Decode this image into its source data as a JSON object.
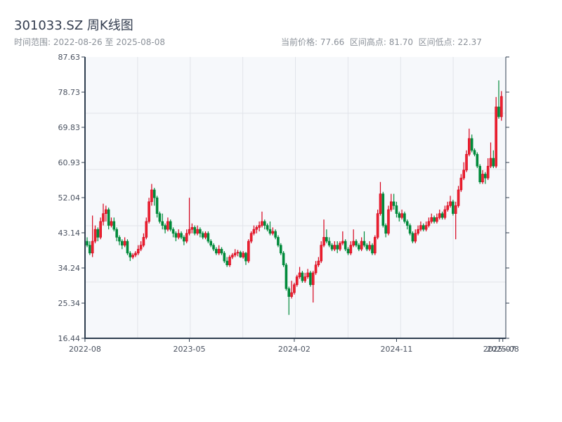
{
  "header": {
    "title": "301033.SZ 周K线图",
    "range_text": "时间范围: 2022-08-26 至 2025-08-08",
    "stats_text": "当前价格: 77.66  区间高点: 81.70  区间低点: 22.37"
  },
  "colors": {
    "up": "#d7001a",
    "up_fill": "#ec2230",
    "down": "#008a3a",
    "axis": "#2f3e50",
    "grid": "#e1e4ea",
    "plot_bg": "#f6f8fb"
  },
  "chart_data": {
    "type": "candlestick",
    "title": "301033.SZ 周K线图",
    "xlabel": "",
    "ylabel": "",
    "start_date": "2022-08-26",
    "end_date": "2025-08-08",
    "interval": "weekly",
    "ylim": [
      16.44,
      87.63
    ],
    "y_ticks": [
      "16.44",
      "25.34",
      "34.24",
      "43.14",
      "52.04",
      "60.93",
      "69.83",
      "78.73",
      "87.63"
    ],
    "x_ticks": [
      {
        "label": "2022-08",
        "index": -0.8
      },
      {
        "label": "2023-05",
        "index": 38
      },
      {
        "label": "2024-02",
        "index": 77
      },
      {
        "label": "2024-11",
        "index": 115
      },
      {
        "label": "2025-07",
        "index": 153.2
      },
      {
        "label": "2025-08",
        "index": 154.5
      }
    ],
    "grid": true,
    "ohlc": [
      [
        41,
        42,
        39.5,
        40
      ],
      [
        40,
        41,
        37.5,
        38
      ],
      [
        38,
        47.5,
        37,
        41
      ],
      [
        41,
        45,
        40.5,
        44
      ],
      [
        44,
        44.5,
        41,
        42
      ],
      [
        42,
        47,
        41.5,
        46
      ],
      [
        46,
        50.5,
        45,
        48
      ],
      [
        48,
        50,
        46,
        49
      ],
      [
        49,
        49.5,
        44,
        45
      ],
      [
        45,
        47,
        44.5,
        46
      ],
      [
        46,
        47,
        43.5,
        44
      ],
      [
        44,
        44.5,
        41,
        42
      ],
      [
        42,
        42.5,
        40,
        41
      ],
      [
        41,
        41.5,
        39,
        40
      ],
      [
        40,
        42,
        39.5,
        41
      ],
      [
        41,
        41.5,
        37.5,
        38
      ],
      [
        38,
        38.5,
        36,
        37
      ],
      [
        37,
        38,
        36.5,
        37.5
      ],
      [
        37.5,
        38.5,
        37,
        38
      ],
      [
        38,
        40,
        37.5,
        39
      ],
      [
        39,
        41,
        38.5,
        40
      ],
      [
        40,
        43,
        39.5,
        42
      ],
      [
        42,
        47,
        41.5,
        46
      ],
      [
        46,
        52,
        45.5,
        51
      ],
      [
        51,
        55.5,
        50,
        54
      ],
      [
        54,
        54.5,
        50,
        52
      ],
      [
        52,
        52.5,
        47,
        48
      ],
      [
        48,
        48.5,
        45.5,
        46
      ],
      [
        46,
        48,
        44,
        45
      ],
      [
        45,
        45.5,
        43,
        44
      ],
      [
        44,
        47,
        43.5,
        46
      ],
      [
        46,
        46.5,
        43.5,
        44
      ],
      [
        44,
        44.5,
        42,
        43
      ],
      [
        43,
        43.5,
        41,
        42
      ],
      [
        42,
        44,
        41.5,
        43
      ],
      [
        43,
        43.5,
        41.5,
        42
      ],
      [
        42,
        42.5,
        40,
        41
      ],
      [
        41,
        44,
        40.5,
        43
      ],
      [
        43,
        52,
        42.5,
        44
      ],
      [
        44,
        45.5,
        43,
        44.5
      ],
      [
        44.5,
        45,
        42.5,
        43
      ],
      [
        43,
        45,
        42.5,
        44
      ],
      [
        44,
        44.5,
        42,
        43
      ],
      [
        43,
        43.5,
        41.5,
        42
      ],
      [
        42,
        43.5,
        41.5,
        43
      ],
      [
        43,
        43.5,
        40.5,
        41
      ],
      [
        41,
        41.5,
        39.5,
        40
      ],
      [
        40,
        40.5,
        38.5,
        39
      ],
      [
        39,
        39.5,
        37.5,
        38
      ],
      [
        38,
        40,
        37.5,
        39
      ],
      [
        39,
        39.5,
        37.5,
        38
      ],
      [
        38,
        38.5,
        35.5,
        36
      ],
      [
        36,
        37,
        34.5,
        35
      ],
      [
        35,
        37.5,
        34.5,
        37
      ],
      [
        37,
        38,
        36.5,
        37.5
      ],
      [
        37.5,
        39,
        37,
        38
      ],
      [
        38,
        38.8,
        37.2,
        38.2
      ],
      [
        38.2,
        38.6,
        36.8,
        37
      ],
      [
        37,
        38.5,
        36.6,
        38
      ],
      [
        38,
        38.3,
        35,
        36
      ],
      [
        36,
        41.5,
        35.5,
        41
      ],
      [
        41,
        43.5,
        40.5,
        43
      ],
      [
        43,
        45,
        42.5,
        44
      ],
      [
        44,
        45,
        43,
        44.5
      ],
      [
        44.5,
        46,
        43.5,
        45
      ],
      [
        45,
        48.5,
        44.5,
        46
      ],
      [
        46,
        46.5,
        44,
        45
      ],
      [
        45,
        45.5,
        43.5,
        44
      ],
      [
        44,
        46,
        42.5,
        43
      ],
      [
        43,
        44.5,
        42.5,
        43.5
      ],
      [
        43.5,
        44,
        41.5,
        42
      ],
      [
        42,
        42.5,
        39.5,
        40
      ],
      [
        40,
        40.5,
        37.5,
        38
      ],
      [
        38,
        38.5,
        34.5,
        35
      ],
      [
        35,
        35.5,
        28.5,
        29
      ],
      [
        29,
        29.5,
        22.37,
        27
      ],
      [
        27,
        31,
        26.5,
        28
      ],
      [
        28,
        30.5,
        27.5,
        30
      ],
      [
        30,
        32.5,
        29.5,
        32
      ],
      [
        32,
        34.5,
        31.5,
        33
      ],
      [
        33,
        33.5,
        30.5,
        31
      ],
      [
        31,
        33,
        30.5,
        32
      ],
      [
        32,
        34,
        31.5,
        33
      ],
      [
        33,
        33.5,
        29.5,
        30
      ],
      [
        30,
        33.5,
        25.5,
        33
      ],
      [
        33,
        36,
        32.5,
        35
      ],
      [
        35,
        37,
        34.5,
        36
      ],
      [
        36,
        41,
        35.5,
        40
      ],
      [
        40,
        46.5,
        39.5,
        42
      ],
      [
        42,
        44,
        40.5,
        41
      ],
      [
        41,
        42,
        39.5,
        40
      ],
      [
        40,
        40.5,
        38.5,
        39
      ],
      [
        39,
        41,
        38.5,
        40
      ],
      [
        40,
        41,
        38,
        39
      ],
      [
        39,
        41,
        38.5,
        40.5
      ],
      [
        40.5,
        43.5,
        40,
        41
      ],
      [
        41,
        41.5,
        38.5,
        39
      ],
      [
        39,
        39.5,
        37.5,
        38
      ],
      [
        38,
        41,
        37.5,
        40
      ],
      [
        40,
        44,
        39.5,
        41
      ],
      [
        41,
        41.5,
        39.5,
        40
      ],
      [
        40,
        40.5,
        38.5,
        39
      ],
      [
        39,
        42,
        38.5,
        41
      ],
      [
        41,
        43.5,
        39.5,
        40
      ],
      [
        40,
        40.5,
        38.5,
        39
      ],
      [
        39,
        41,
        38.5,
        40
      ],
      [
        40,
        40.5,
        37.5,
        38
      ],
      [
        38,
        42.5,
        37.5,
        42
      ],
      [
        42,
        49,
        41.5,
        48
      ],
      [
        48,
        56,
        47.5,
        53
      ],
      [
        53,
        53.5,
        44.5,
        45
      ],
      [
        45,
        45.5,
        42,
        43
      ],
      [
        43,
        50,
        42.5,
        49
      ],
      [
        49,
        53,
        48.5,
        51
      ],
      [
        51,
        53,
        49,
        50
      ],
      [
        50,
        51,
        47,
        48
      ],
      [
        48,
        48.5,
        46,
        47
      ],
      [
        47,
        49,
        46.5,
        48
      ],
      [
        48,
        48.5,
        45.5,
        46
      ],
      [
        46,
        46.5,
        44,
        45
      ],
      [
        45,
        45.5,
        42.5,
        43
      ],
      [
        43,
        43.5,
        40.5,
        41
      ],
      [
        41,
        44,
        40.5,
        43
      ],
      [
        43,
        45,
        42.5,
        44
      ],
      [
        44,
        46,
        43.5,
        45
      ],
      [
        45,
        45.5,
        43.5,
        44
      ],
      [
        44,
        46,
        43.5,
        45
      ],
      [
        45,
        47,
        44.5,
        46
      ],
      [
        46,
        48,
        45.5,
        47
      ],
      [
        47,
        47.5,
        45.5,
        46
      ],
      [
        46,
        48,
        45.5,
        47
      ],
      [
        47,
        49,
        46.5,
        48
      ],
      [
        48,
        48.5,
        46.5,
        47
      ],
      [
        47,
        50,
        46.5,
        49
      ],
      [
        49,
        51,
        48.5,
        50
      ],
      [
        50,
        52.5,
        49.5,
        51
      ],
      [
        51,
        51.5,
        47.5,
        48
      ],
      [
        48,
        51,
        41.5,
        50
      ],
      [
        50,
        55,
        49.5,
        54
      ],
      [
        54,
        58,
        53.5,
        57
      ],
      [
        57,
        61,
        56.5,
        59
      ],
      [
        59,
        64,
        58.5,
        63
      ],
      [
        63,
        69.5,
        62.5,
        67
      ],
      [
        67,
        68,
        63.5,
        64
      ],
      [
        64,
        64.5,
        62.5,
        63
      ],
      [
        63,
        63.5,
        59.5,
        60
      ],
      [
        60,
        60.5,
        55.5,
        56
      ],
      [
        56,
        59,
        55.5,
        58
      ],
      [
        58,
        58.5,
        55.5,
        57
      ],
      [
        57,
        62,
        56.5,
        60
      ],
      [
        60,
        66,
        59.5,
        62
      ],
      [
        62,
        64,
        59.5,
        60
      ],
      [
        60,
        77.5,
        59.5,
        75
      ],
      [
        75,
        81.7,
        72,
        72.5
      ],
      [
        72.5,
        79,
        71.5,
        77.66
      ]
    ]
  }
}
